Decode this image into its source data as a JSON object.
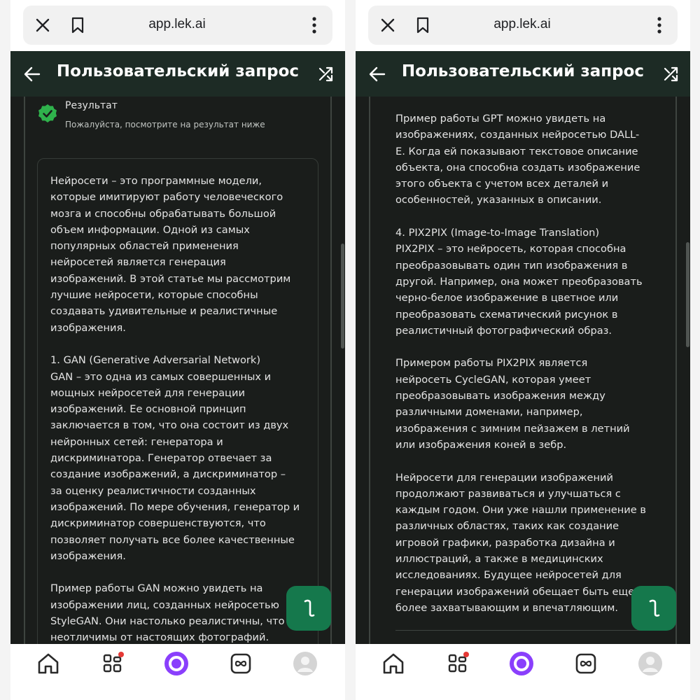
{
  "browser": {
    "url": "app.lek.ai"
  },
  "header": {
    "title": "Пользовательский запрос"
  },
  "result": {
    "title": "Результат",
    "subtitle": "Пожалуйста, посмотрите на результат ниже"
  },
  "article_left": {
    "text": "Нейросети – это программные модели,\nкоторые имитируют работу человеческого\nмозга и способны обрабатывать большой\nобъем информации. Одной из самых\nпопулярных областей применения\nнейросетей является генерация\nизображений. В этой статье мы рассмотрим\nлучшие нейросети, которые способны\nсоздавать удивительные и реалистичные\nизображения.\n\n1. GAN (Generative Adversarial Network)\nGAN – это одна из самых совершенных и\nмощных нейросетей для генерации\nизображений. Ее основной принцип\nзаключается в том, что она состоит из двух\nнейронных сетей: генератора и\nдискриминатора. Генератор отвечает за\nсоздание изображений, а дискриминатор –\nза оценку реалистичности созданных\nизображений. По мере обучения, генератор и\nдискриминатор совершенствуются, что\nпозволяет получать все более качественные\nизображения.\n\nПример работы GAN можно увидеть на\nизображении лиц, созданных нейросетью\nStyleGAN. Они настолько реалистичны, что\nнеотличимы от настоящих фотографий."
  },
  "article_right": {
    "text": "Пример работы GPT можно увидеть на\nизображениях, созданных нейросетью DALL-\nE. Когда ей показывают текстовое описание\nобъекта, она способна создать изображение\nэтого объекта с учетом всех деталей и\nособенностей, указанных в описании.\n\n4. PIX2PIX (Image-to-Image Translation)\nPIX2PIX – это нейросеть, которая способна\nпреобразовывать один тип изображения в\nдругой. Например, она может преобразовать\nчерно-белое изображение в цветное или\nпреобразовать схематический рисунок в\nреалистичный фотографический образ.\n\nПримером работы PIX2PIX является\nнейросеть CycleGAN, которая умеет\nпреобразовывать изображения между\nразличными доменами, например,\nизображения с зимним пейзажем в летний\nили изображения коней в зебр.\n\nНейросети для генерации изображений\nпродолжают развиваться и улучшаться с\nкаждым годом. Они уже нашли применение в\nразличных областях, таких как создание\nигровой графики, разработка дизайна и\nиллюстраций, а также в медицинских\nисследованиях. Будущее нейросетей для\nгенерации изображений обещает быть еще\nболее захватывающим и впечатляющим."
  },
  "icons": {
    "close": "close-icon",
    "bookmark": "bookmark-icon",
    "more": "more-vertical-icon",
    "back": "arrow-left-icon",
    "shuffle": "shuffle-icon",
    "check": "check-circle-icon",
    "fab": "text-cursor-icon",
    "nav": [
      "home-icon",
      "services-icon",
      "alice-icon",
      "media-icon",
      "profile-icon"
    ]
  },
  "colors": {
    "header_bg": "#1d2b25",
    "content_bg": "#1a1d1b",
    "accent_green": "#15784c",
    "check_green": "#2fb24c",
    "alice_purple": "#8a3ffc",
    "notification_red": "#e53935"
  }
}
